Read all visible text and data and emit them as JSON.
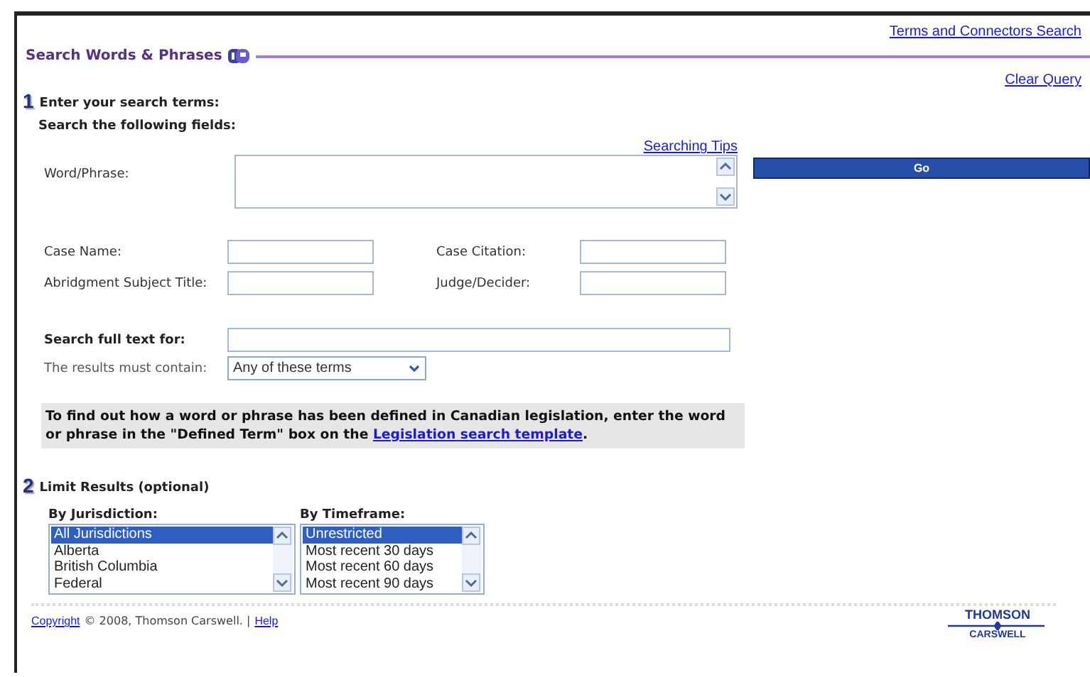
{
  "top_link": "Terms and Connectors Search",
  "section_title": "Search Words & Phrases",
  "clear_link": "Clear Query",
  "step1": {
    "number": "1",
    "title": "Enter your search terms:",
    "subtitle": "Search the following fields:"
  },
  "tips_link": "Searching Tips",
  "word_phrase": {
    "label": "Word/Phrase:",
    "go": "Go"
  },
  "fields": [
    {
      "label": "Case Name:"
    },
    {
      "label": "Case Citation:"
    },
    {
      "label": "Abridgment Subject Title:"
    },
    {
      "label": "Judge/Decider:"
    }
  ],
  "full_text": {
    "label": "Search full text for:"
  },
  "must_contain": {
    "label": "The results must contain:",
    "value": "Any of these terms"
  },
  "note": {
    "text": "To find out how a word or phrase has been defined in Canadian legislation, enter the word or phrase in the \"Defined Term\" box on the ",
    "link": "Legislation search template",
    "after": "."
  },
  "step2": {
    "number": "2",
    "title": "Limit Results (optional)"
  },
  "lists": [
    {
      "label": "By Jurisdiction:",
      "items": [
        {
          "text": "All Jurisdictions",
          "selected": true
        },
        {
          "text": "Alberta",
          "selected": false
        },
        {
          "text": "British Columbia",
          "selected": false
        },
        {
          "text": "Federal",
          "selected": false
        }
      ]
    },
    {
      "label": "By Timeframe:",
      "items": [
        {
          "text": "Unrestricted",
          "selected": true
        },
        {
          "text": "Most recent 30 days",
          "selected": false
        },
        {
          "text": "Most recent 60 days",
          "selected": false
        },
        {
          "text": "Most recent 90 days",
          "selected": false
        }
      ]
    }
  ],
  "footer": {
    "copyright_link": "Copyright",
    "text": "© 2008, Thomson Carswell. |",
    "help_link": "Help"
  },
  "logo": {
    "top": "THOMSON",
    "bottom": "CARSWELL"
  }
}
